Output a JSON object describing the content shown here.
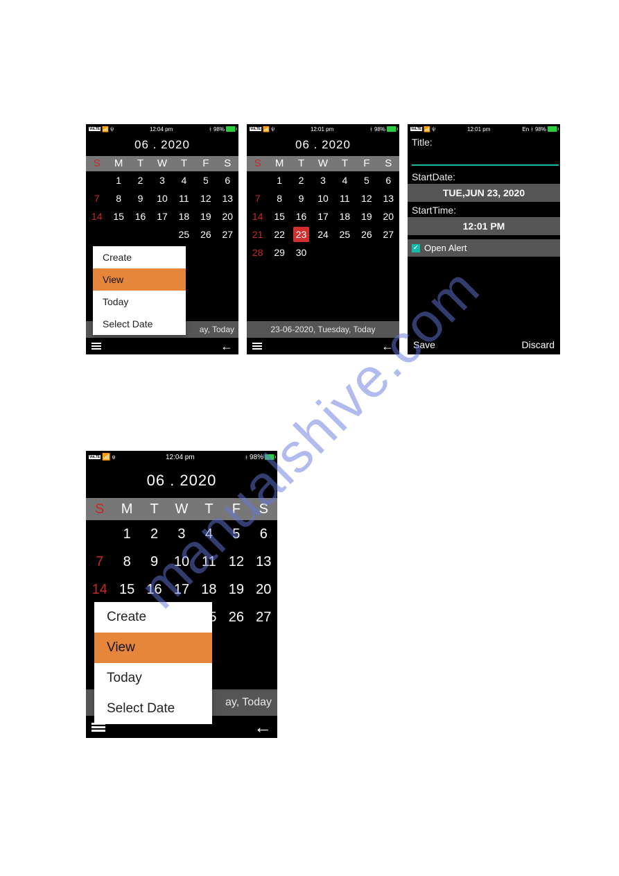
{
  "watermark": "manualshive.com",
  "status": {
    "time_a": "12:04 pm",
    "time_b": "12:01 pm",
    "batt": "98%",
    "volte": "VoLTE",
    "en": "En"
  },
  "calendar": {
    "title": "06 . 2020",
    "dow": [
      "S",
      "M",
      "T",
      "W",
      "T",
      "F",
      "S"
    ],
    "weeks": [
      [
        "",
        "1",
        "2",
        "3",
        "4",
        "5",
        "6"
      ],
      [
        "7",
        "8",
        "9",
        "10",
        "11",
        "12",
        "13"
      ],
      [
        "14",
        "15",
        "16",
        "17",
        "18",
        "19",
        "20"
      ],
      [
        "21",
        "22",
        "23",
        "24",
        "25",
        "26",
        "27"
      ],
      [
        "28",
        "29",
        "30",
        "",
        "",
        "",
        ""
      ]
    ],
    "footer_full": "23-06-2020, Tuesday, Today",
    "footer_cut": "ay, Today"
  },
  "menu": {
    "create": "Create",
    "view": "View",
    "today": "Today",
    "select_date": "Select Date"
  },
  "form": {
    "title_label": "Title:",
    "startdate_label": "StartDate:",
    "startdate_value": "TUE,JUN 23, 2020",
    "starttime_label": "StartTime:",
    "starttime_value": "12:01 PM",
    "open_alert": "Open Alert",
    "save": "Save",
    "discard": "Discard"
  }
}
